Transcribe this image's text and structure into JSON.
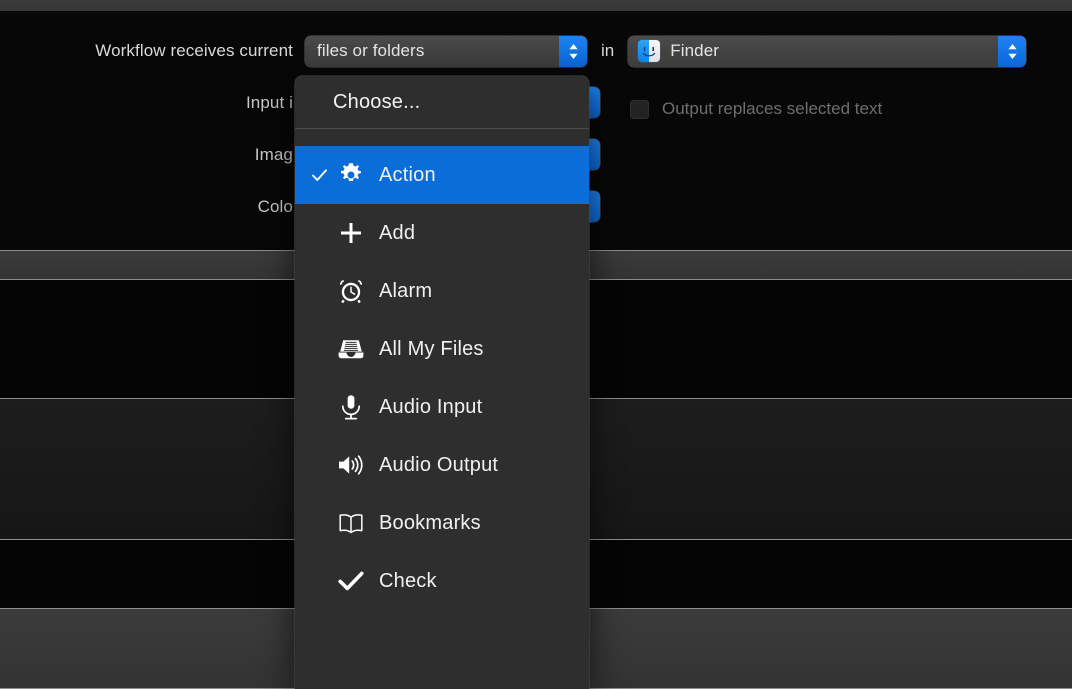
{
  "window": {
    "titlebar_visible": true
  },
  "config": {
    "receives_label": "Workflow receives current",
    "receives_value": "files or folders",
    "in_word": "in",
    "app_value": "Finder",
    "app_icon": "finder-icon",
    "input_label": "Input i",
    "image_label": "Imag",
    "color_label": "Colo",
    "checkbox_label": "Output replaces selected text",
    "checkbox_checked": false
  },
  "colors": {
    "accent": "#0b6ed8",
    "stepper_blue": "#1f82f0",
    "menu_background": "#2e2e2e",
    "panel_background": "#070707",
    "band_light": "#3b3b3b",
    "band_mid": "#1d1d1d"
  },
  "menu": {
    "header": "Choose...",
    "items": [
      {
        "label": "Action",
        "icon": "gear-icon",
        "checked": true,
        "selected": true
      },
      {
        "label": "Add",
        "icon": "plus-icon",
        "checked": false,
        "selected": false
      },
      {
        "label": "Alarm",
        "icon": "alarm-clock-icon",
        "checked": false,
        "selected": false
      },
      {
        "label": "All My Files",
        "icon": "file-tray-icon",
        "checked": false,
        "selected": false
      },
      {
        "label": "Audio Input",
        "icon": "microphone-icon",
        "checked": false,
        "selected": false
      },
      {
        "label": "Audio Output",
        "icon": "speaker-icon",
        "checked": false,
        "selected": false
      },
      {
        "label": "Bookmarks",
        "icon": "open-book-icon",
        "checked": false,
        "selected": false
      },
      {
        "label": "Check",
        "icon": "checkmark-icon",
        "checked": false,
        "selected": false
      }
    ]
  }
}
